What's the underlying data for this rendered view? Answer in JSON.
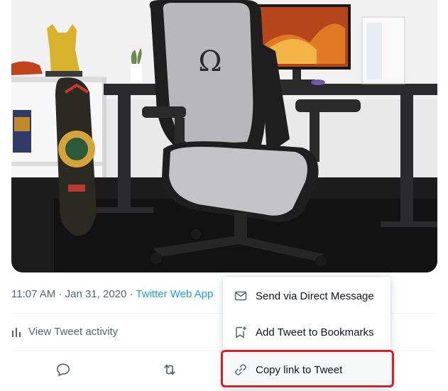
{
  "tweet": {
    "time": "11:07 AM",
    "separator": " · ",
    "date": "Jan 31, 2020",
    "source": "Twitter Web App"
  },
  "activity": {
    "label": "View Tweet activity",
    "icon": "bar-chart-icon"
  },
  "actions": [
    {
      "name": "reply",
      "icon": "reply-icon"
    },
    {
      "name": "retweet",
      "icon": "retweet-icon"
    }
  ],
  "share_menu": {
    "items": [
      {
        "label": "Send via Direct Message",
        "icon": "envelope-icon"
      },
      {
        "label": "Add Tweet to Bookmarks",
        "icon": "bookmark-add-icon"
      },
      {
        "label": "Copy link to Tweet",
        "icon": "link-icon",
        "highlighted": true
      }
    ]
  },
  "photo": {
    "logo_glyph": "Ω"
  },
  "colors": {
    "link": "#1d9bf0",
    "secondary_text": "#536471",
    "primary_text": "#0f1419",
    "highlight_border": "#d8202a"
  }
}
